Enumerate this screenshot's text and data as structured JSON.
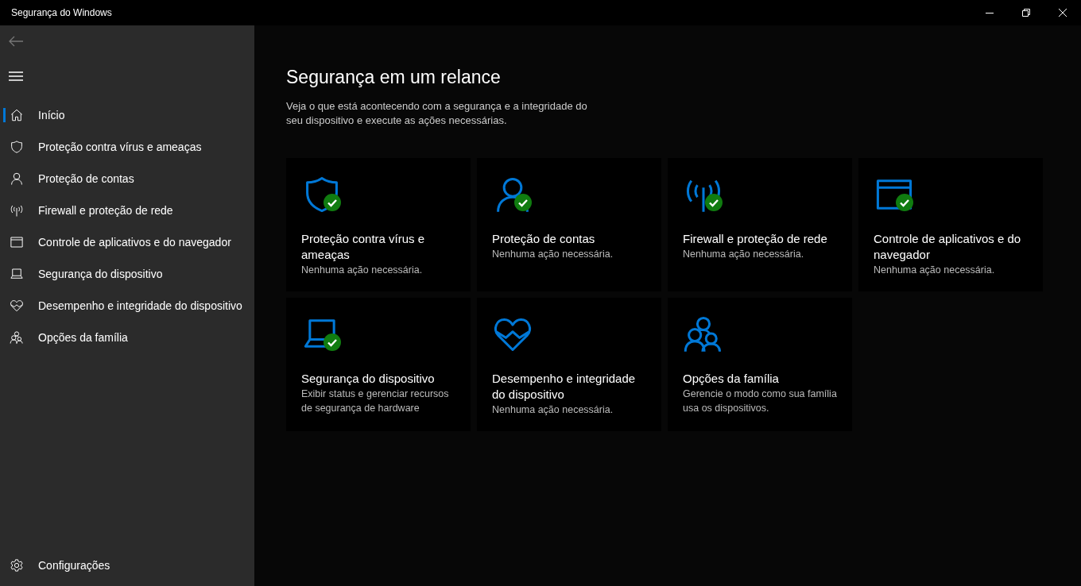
{
  "window": {
    "title": "Segurança do Windows"
  },
  "sidebar": {
    "items": [
      {
        "kind": "home",
        "label": "Início",
        "selected": true
      },
      {
        "kind": "shield",
        "label": "Proteção contra vírus e ameaças",
        "selected": false
      },
      {
        "kind": "person",
        "label": "Proteção de contas",
        "selected": false
      },
      {
        "kind": "antenna",
        "label": "Firewall e proteção de rede",
        "selected": false
      },
      {
        "kind": "browser",
        "label": "Controle de aplicativos e do navegador",
        "selected": false
      },
      {
        "kind": "laptop",
        "label": "Segurança do dispositivo",
        "selected": false
      },
      {
        "kind": "heart",
        "label": "Desempenho e integridade do dispositivo",
        "selected": false
      },
      {
        "kind": "family",
        "label": "Opções da família",
        "selected": false
      }
    ],
    "settings": {
      "label": "Configurações"
    }
  },
  "main": {
    "heading": "Segurança em um relance",
    "description": "Veja o que está acontecendo com a segurança e a integridade do seu dispositivo e execute as ações necessárias.",
    "cards": [
      {
        "kind": "shield",
        "ok": true,
        "title": "Proteção contra vírus e ameaças",
        "status": "Nenhuma ação necessária."
      },
      {
        "kind": "person",
        "ok": true,
        "title": "Proteção de contas",
        "status": "Nenhuma ação necessária."
      },
      {
        "kind": "antenna",
        "ok": true,
        "title": "Firewall e proteção de rede",
        "status": "Nenhuma ação necessária."
      },
      {
        "kind": "browser",
        "ok": true,
        "title": "Controle de aplicativos e do navegador",
        "status": "Nenhuma ação necessária."
      },
      {
        "kind": "laptop",
        "ok": true,
        "title": "Segurança do dispositivo",
        "status": "Exibir status e gerenciar recursos de segurança de hardware"
      },
      {
        "kind": "heart",
        "ok": false,
        "title": "Desempenho e integridade do dispositivo",
        "status": "Nenhuma ação necessária."
      },
      {
        "kind": "family",
        "ok": false,
        "title": "Opções da família",
        "status": "Gerencie o modo como sua família usa os dispositivos."
      }
    ]
  }
}
